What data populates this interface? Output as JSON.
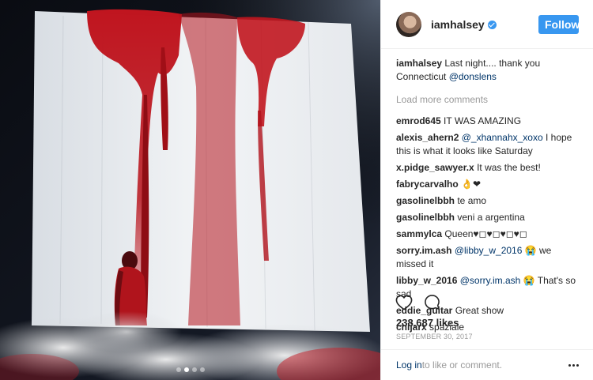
{
  "post": {
    "username": "iamhalsey",
    "follow_label": "Follow",
    "caption_user": "iamhalsey",
    "caption_text": " Last night.... thank you Connecticut ",
    "caption_mention": "@donslens",
    "load_more": "Load more comments",
    "likes": "238,687 likes",
    "date": "SEPTEMBER 30, 2017",
    "login_link": "Log in",
    "login_rest": " to like or comment."
  },
  "comments": [
    {
      "user": "emrod645",
      "mention": "",
      "text": " IT WAS AMAZING"
    },
    {
      "user": "alexis_ahern2",
      "mention": " @_xhannahx_xoxo",
      "text": " I hope this is what it looks like Saturday"
    },
    {
      "user": "x.pidge_sawyer.x",
      "mention": "",
      "text": " It was the best!"
    },
    {
      "user": "fabrycarvalho",
      "mention": "",
      "text": " 👌❤"
    },
    {
      "user": "gasolinelbbh",
      "mention": "",
      "text": " te amo"
    },
    {
      "user": "gasolinelbbh",
      "mention": "",
      "text": " veni a argentina"
    },
    {
      "user": "sammylca",
      "mention": "",
      "text": " Queen♥◻♥◻♥◻♥◻"
    },
    {
      "user": "sorry.im.ash",
      "mention": " @libby_w_2016",
      "text": " 😭 we missed it"
    },
    {
      "user": "libby_w_2016",
      "mention": " @sorry.im.ash",
      "text": " 😭 That's so sad"
    },
    {
      "user": "eddie_guitar",
      "mention": "",
      "text": " Great show"
    },
    {
      "user": "chijarx",
      "mention": "",
      "text": " spaziale"
    }
  ],
  "icons": {
    "heart": "heart-icon",
    "comment": "comment-icon",
    "more": "more-options-icon",
    "verified": "verified-badge-icon"
  },
  "colors": {
    "accent": "#3897f0",
    "link": "#003569",
    "muted": "#999999",
    "blood_red": "#b5121b"
  },
  "carousel": {
    "count": 4,
    "active": 1
  }
}
